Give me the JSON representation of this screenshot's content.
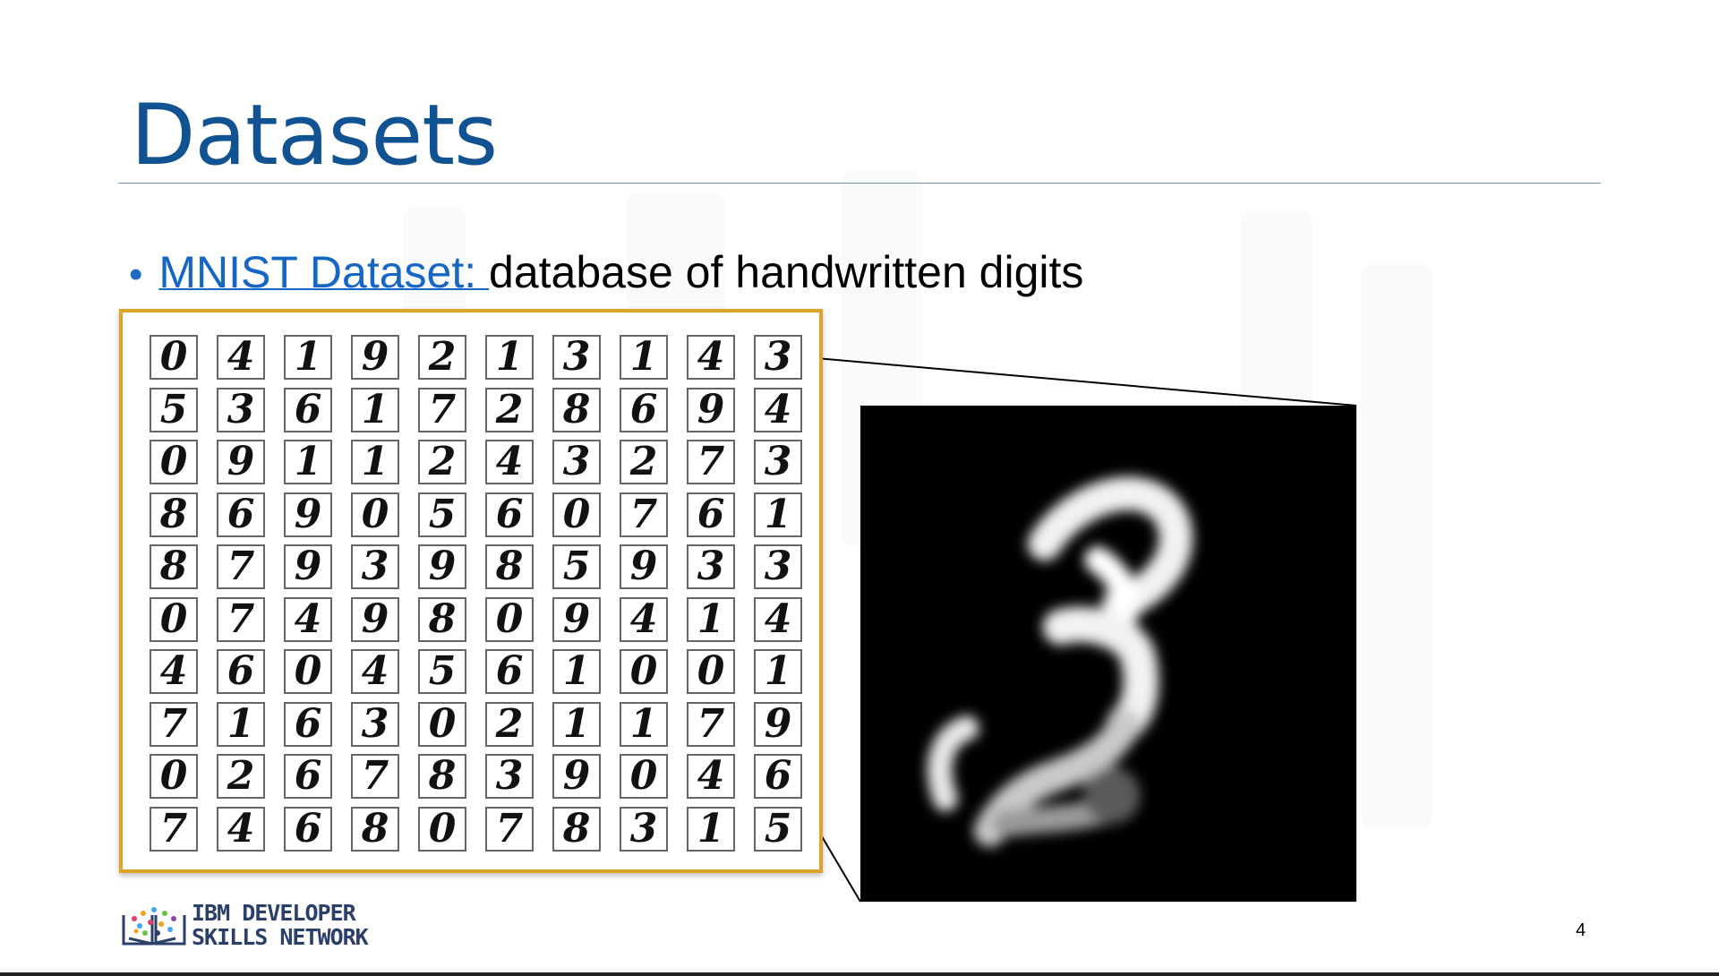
{
  "slide": {
    "title": "Datasets",
    "bullet": {
      "link_text": "MNIST Dataset: ",
      "text": "database of handwritten digits"
    },
    "digit_grid": [
      [
        "0",
        "4",
        "1",
        "9",
        "2",
        "1",
        "3",
        "1",
        "4",
        "3"
      ],
      [
        "5",
        "3",
        "6",
        "1",
        "7",
        "2",
        "8",
        "6",
        "9",
        "4"
      ],
      [
        "0",
        "9",
        "1",
        "1",
        "2",
        "4",
        "3",
        "2",
        "7",
        "3"
      ],
      [
        "8",
        "6",
        "9",
        "0",
        "5",
        "6",
        "0",
        "7",
        "6",
        "1"
      ],
      [
        "8",
        "7",
        "9",
        "3",
        "9",
        "8",
        "5",
        "9",
        "3",
        "3"
      ],
      [
        "0",
        "7",
        "4",
        "9",
        "8",
        "0",
        "9",
        "4",
        "1",
        "4"
      ],
      [
        "4",
        "6",
        "0",
        "4",
        "5",
        "6",
        "1",
        "0",
        "0",
        "1"
      ],
      [
        "7",
        "1",
        "6",
        "3",
        "0",
        "2",
        "1",
        "1",
        "7",
        "9"
      ],
      [
        "0",
        "2",
        "6",
        "7",
        "8",
        "3",
        "9",
        "0",
        "4",
        "6"
      ],
      [
        "7",
        "4",
        "6",
        "8",
        "0",
        "7",
        "8",
        "3",
        "1",
        "5"
      ]
    ],
    "zoom_digit": "3",
    "page_number": "4",
    "logo": {
      "line1": "IBM DEVELOPER",
      "line2": "SKILLS NETWORK"
    }
  },
  "colors": {
    "title": "#115293",
    "link": "#1667c5",
    "frame_border": "#e0a32a",
    "logo_text": "#2b3f6b"
  }
}
